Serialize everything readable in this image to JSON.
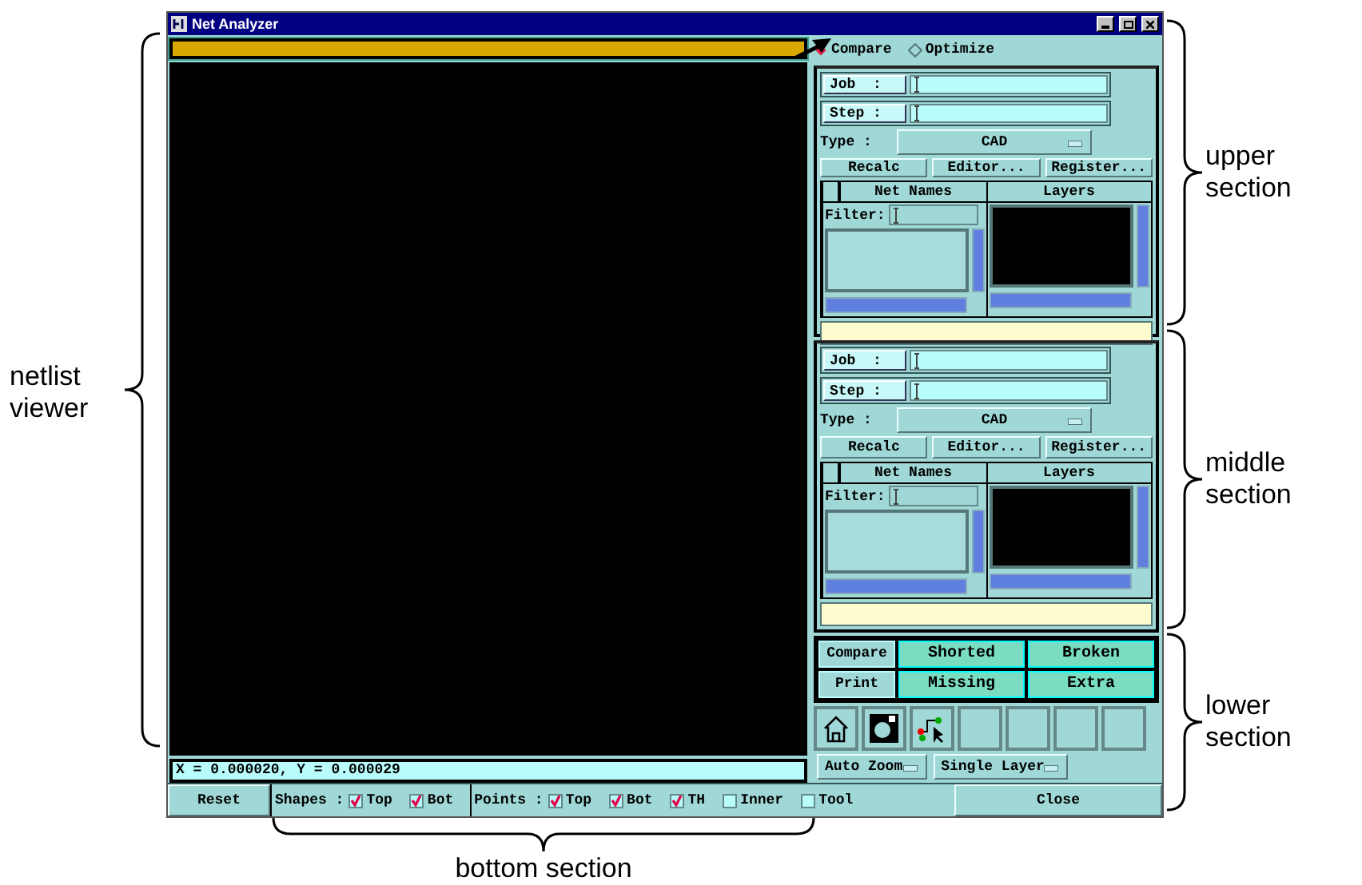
{
  "window": {
    "title": "Net Analyzer"
  },
  "viewer": {
    "coordinates": "X = 0.000020, Y = 0.000029"
  },
  "mode_options": [
    {
      "label": "Compare",
      "selected": true
    },
    {
      "label": "Optimize",
      "selected": false
    }
  ],
  "sections": [
    {
      "job_label": "Job  :",
      "step_label": "Step :",
      "type_label": "Type :",
      "type_value": "CAD",
      "buttons": [
        "Recalc",
        "Editor...",
        "Register..."
      ],
      "columns": [
        "Net Names",
        "Layers"
      ],
      "filter_label": "Filter:"
    },
    {
      "job_label": "Job  :",
      "step_label": "Step :",
      "type_label": "Type :",
      "type_value": "CAD",
      "buttons": [
        "Recalc",
        "Editor...",
        "Register..."
      ],
      "columns": [
        "Net Names",
        "Layers"
      ],
      "filter_label": "Filter:"
    }
  ],
  "lower_buttons": [
    {
      "label": "Compare",
      "kind": "plain"
    },
    {
      "label": "Shorted",
      "kind": "category"
    },
    {
      "label": "Broken",
      "kind": "category"
    },
    {
      "label": "Print",
      "kind": "plain"
    },
    {
      "label": "Missing",
      "kind": "category"
    },
    {
      "label": "Extra",
      "kind": "category"
    }
  ],
  "tools": [
    {
      "kind": "home"
    },
    {
      "kind": "lens"
    },
    {
      "kind": "path"
    },
    {
      "kind": "empty"
    },
    {
      "kind": "empty"
    },
    {
      "kind": "empty"
    },
    {
      "kind": "empty"
    }
  ],
  "dropdowns": [
    "Auto Zoom",
    "Single Layer"
  ],
  "bottom_bar": {
    "reset": "Reset",
    "shapes_label": "Shapes :",
    "shapes": [
      {
        "label": "Top",
        "checked": true
      },
      {
        "label": "Bot",
        "checked": true
      }
    ],
    "points_label": "Points :",
    "points": [
      {
        "label": "Top",
        "checked": true
      },
      {
        "label": "Bot",
        "checked": true
      },
      {
        "label": "TH",
        "checked": true
      }
    ],
    "options": [
      {
        "label": "Inner",
        "checked": false
      },
      {
        "label": "Tool",
        "checked": false
      }
    ],
    "close": "Close"
  },
  "annotations": {
    "left": [
      "netlist viewer"
    ],
    "right": [
      "upper section",
      "middle section",
      "lower section"
    ],
    "bottom": [
      "bottom section"
    ]
  }
}
